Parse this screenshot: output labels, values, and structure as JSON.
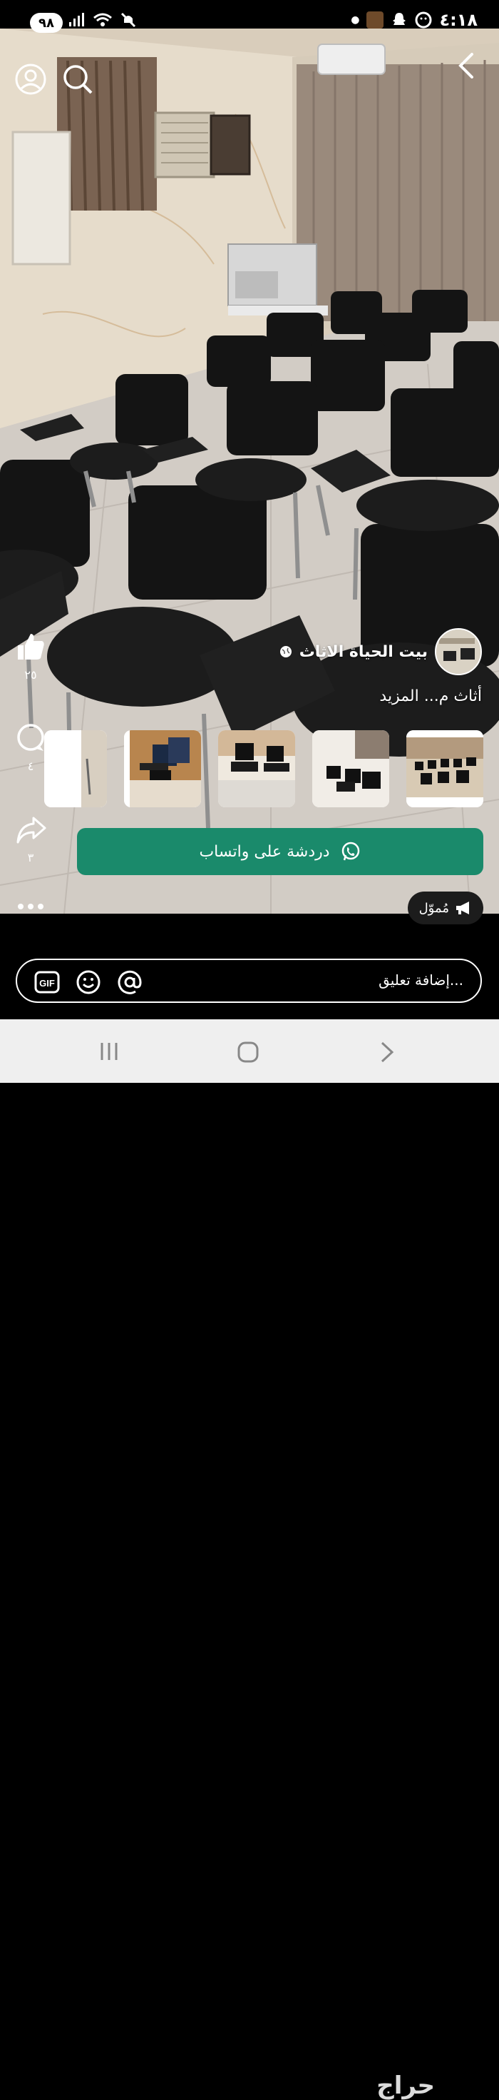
{
  "status_bar": {
    "battery": "٩٨",
    "time": "٤:١٨"
  },
  "actions": {
    "likes": "٢٥",
    "comments": "٤",
    "shares": "٣"
  },
  "seller": {
    "name": "بيت الحياة الاثاث"
  },
  "post": {
    "description": "أثاث م... المزيد"
  },
  "whatsapp_button": {
    "label": "دردشة على واتساب"
  },
  "sponsored_badge": {
    "label": "مُموّل"
  },
  "comment_bar": {
    "placeholder": "إضافة تعليق...",
    "gif_label": "GIF"
  },
  "watermark": "حراج",
  "icons": [
    "profile-icon",
    "search-icon",
    "back-icon",
    "like-icon",
    "comment-icon",
    "share-icon",
    "more-icon",
    "whatsapp-icon",
    "megaphone-icon",
    "gif-icon",
    "emoji-icon",
    "mention-icon",
    "recents-icon",
    "home-icon",
    "nav-back-icon",
    "globe-icon"
  ],
  "colors": {
    "whatsapp_green": "#1a8a6b",
    "nav_bar": "#efefef"
  }
}
